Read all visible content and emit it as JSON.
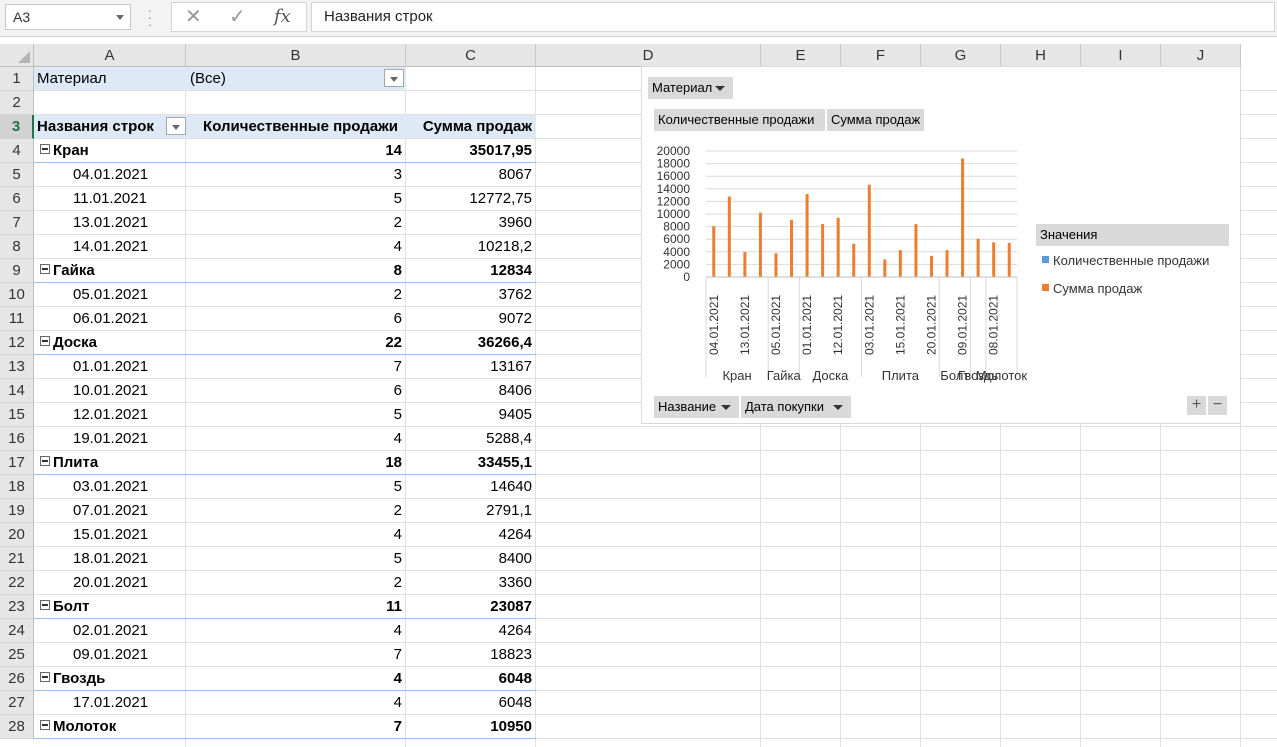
{
  "formula_bar": {
    "name_box": "A3",
    "cancel_icon": "✕",
    "enter_icon": "✓",
    "fx_label": "fx",
    "formula": "Названия строк"
  },
  "columns": [
    "A",
    "B",
    "C",
    "D",
    "E",
    "F",
    "G",
    "H",
    "I",
    "J"
  ],
  "rows": [
    "1",
    "2",
    "3",
    "4",
    "5",
    "6",
    "7",
    "8",
    "9",
    "10",
    "11",
    "12",
    "13",
    "14",
    "15",
    "16",
    "17",
    "18",
    "19",
    "20",
    "21",
    "22",
    "23",
    "24",
    "25",
    "26",
    "27",
    "28"
  ],
  "pivot": {
    "filter_label": "Материал",
    "filter_value": "(Все)",
    "header": {
      "rows_label": "Названия строк",
      "qty": "Количественные продажи",
      "sum": "Сумма продаж"
    },
    "lines": [
      {
        "label": "Кран",
        "qty": "14",
        "sum": "35017,95",
        "group": true
      },
      {
        "label": "04.01.2021",
        "qty": "3",
        "sum": "8067"
      },
      {
        "label": "11.01.2021",
        "qty": "5",
        "sum": "12772,75"
      },
      {
        "label": "13.01.2021",
        "qty": "2",
        "sum": "3960"
      },
      {
        "label": "14.01.2021",
        "qty": "4",
        "sum": "10218,2"
      },
      {
        "label": "Гайка",
        "qty": "8",
        "sum": "12834",
        "group": true
      },
      {
        "label": "05.01.2021",
        "qty": "2",
        "sum": "3762"
      },
      {
        "label": "06.01.2021",
        "qty": "6",
        "sum": "9072"
      },
      {
        "label": "Доска",
        "qty": "22",
        "sum": "36266,4",
        "group": true
      },
      {
        "label": "01.01.2021",
        "qty": "7",
        "sum": "13167"
      },
      {
        "label": "10.01.2021",
        "qty": "6",
        "sum": "8406"
      },
      {
        "label": "12.01.2021",
        "qty": "5",
        "sum": "9405"
      },
      {
        "label": "19.01.2021",
        "qty": "4",
        "sum": "5288,4"
      },
      {
        "label": "Плита",
        "qty": "18",
        "sum": "33455,1",
        "group": true
      },
      {
        "label": "03.01.2021",
        "qty": "5",
        "sum": "14640"
      },
      {
        "label": "07.01.2021",
        "qty": "2",
        "sum": "2791,1"
      },
      {
        "label": "15.01.2021",
        "qty": "4",
        "sum": "4264"
      },
      {
        "label": "18.01.2021",
        "qty": "5",
        "sum": "8400"
      },
      {
        "label": "20.01.2021",
        "qty": "2",
        "sum": "3360"
      },
      {
        "label": "Болт",
        "qty": "11",
        "sum": "23087",
        "group": true
      },
      {
        "label": "02.01.2021",
        "qty": "4",
        "sum": "4264"
      },
      {
        "label": "09.01.2021",
        "qty": "7",
        "sum": "18823"
      },
      {
        "label": "Гвоздь",
        "qty": "4",
        "sum": "6048",
        "group": true
      },
      {
        "label": "17.01.2021",
        "qty": "4",
        "sum": "6048"
      },
      {
        "label": "Молоток",
        "qty": "7",
        "sum": "10950",
        "group": true
      }
    ]
  },
  "pivot_chart": {
    "filter_button": "Материал",
    "value_buttons": [
      "Количественные  продажи",
      "Сумма  продаж"
    ],
    "axis_buttons": [
      "Название",
      "Дата покупки"
    ],
    "legend_title": "Значения",
    "legend": [
      {
        "name": "Количественные продажи",
        "color": "#5b9bd5"
      },
      {
        "name": "Сумма продаж",
        "color": "#ed7d31"
      }
    ],
    "zoom_in": "+",
    "zoom_out": "−"
  },
  "chart_data": {
    "type": "bar",
    "ylim": [
      0,
      20000
    ],
    "yticks": [
      "0",
      "2000",
      "4000",
      "6000",
      "8000",
      "10000",
      "12000",
      "14000",
      "16000",
      "18000",
      "20000"
    ],
    "categories": [
      "04.01.2021",
      "11.01.2021",
      "13.01.2021",
      "14.01.2021",
      "05.01.2021",
      "06.01.2021",
      "01.01.2021",
      "10.01.2021",
      "12.01.2021",
      "19.01.2021",
      "03.01.2021",
      "07.01.2021",
      "15.01.2021",
      "18.01.2021",
      "20.01.2021",
      "02.01.2021",
      "09.01.2021",
      "17.01.2021",
      "08.01.2021",
      "16.01.2021"
    ],
    "visible_tick_labels": [
      "04.01.2021",
      "13.01.2021",
      "05.01.2021",
      "01.01.2021",
      "12.01.2021",
      "03.01.2021",
      "15.01.2021",
      "20.01.2021",
      "09.01.2021",
      "08.01.2021"
    ],
    "groups": [
      {
        "name": "Кран",
        "count": 4
      },
      {
        "name": "Гайка",
        "count": 2
      },
      {
        "name": "Доска",
        "count": 4
      },
      {
        "name": "Плита",
        "count": 5
      },
      {
        "name": "Болт",
        "count": 2
      },
      {
        "name": "Гвоздь",
        "count": 1
      },
      {
        "name": "Молоток",
        "count": 2
      }
    ],
    "series": [
      {
        "name": "Количественные продажи",
        "color": "#5b9bd5",
        "values": [
          3,
          5,
          2,
          4,
          2,
          6,
          7,
          6,
          5,
          4,
          5,
          2,
          4,
          5,
          2,
          4,
          7,
          4,
          3,
          4
        ]
      },
      {
        "name": "Сумма продаж",
        "color": "#ed7d31",
        "values": [
          8067,
          12772.75,
          3960,
          10218.2,
          3762,
          9072,
          13167,
          8406,
          9405,
          5288.4,
          14640,
          2791.1,
          4264,
          8400,
          3360,
          4264,
          18823,
          6048,
          5500,
          5400
        ]
      }
    ]
  }
}
